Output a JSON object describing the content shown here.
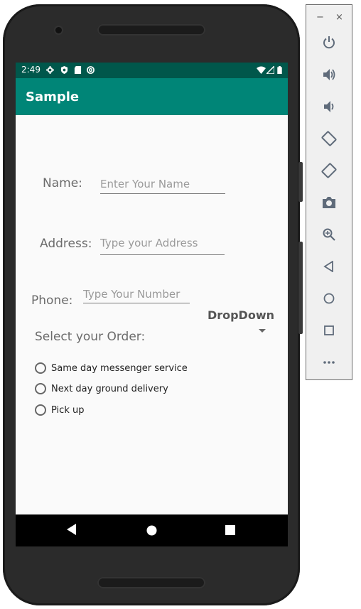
{
  "status_bar": {
    "time": "2:49"
  },
  "app_bar": {
    "title": "Sample"
  },
  "form": {
    "name_label": "Name:",
    "name_placeholder": "Enter Your Name",
    "address_label": "Address:",
    "address_placeholder": "Type your Address",
    "phone_label": "Phone:",
    "phone_placeholder": "Type Your Number",
    "dropdown_label": "DropDown",
    "order_label": "Select your Order:",
    "options": [
      "Same day messenger service",
      "Next day ground delivery",
      "Pick up"
    ]
  },
  "emulator_panel": {
    "minimize": "−",
    "close": "×",
    "tools": [
      "power-icon",
      "volume-up-icon",
      "volume-down-icon",
      "rotate-left-icon",
      "rotate-right-icon",
      "camera-icon",
      "zoom-icon",
      "back-icon",
      "home-icon",
      "overview-icon",
      "more-icon"
    ]
  },
  "colors": {
    "primary": "#008577",
    "primary_dark": "#00574b",
    "background": "#fafafa"
  }
}
